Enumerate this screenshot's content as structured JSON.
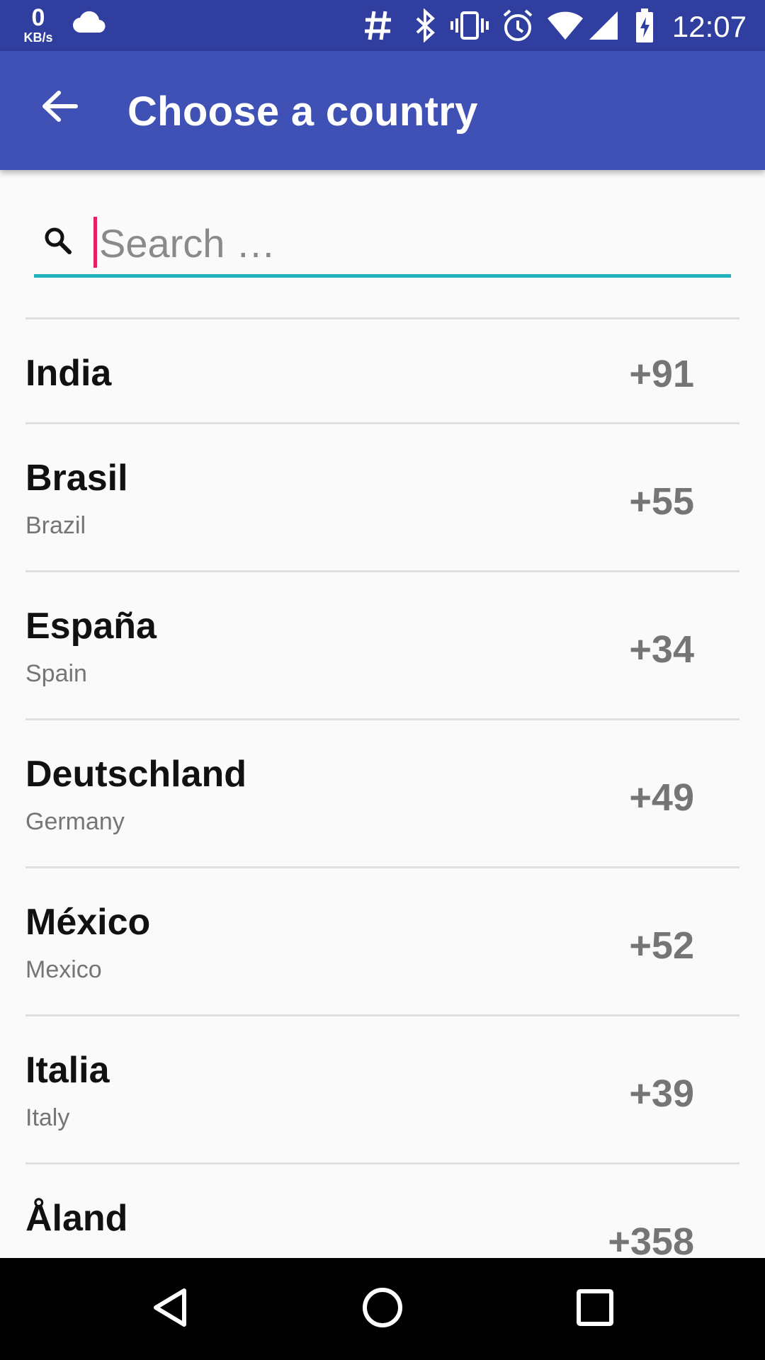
{
  "status_bar": {
    "net_speed_value": "0",
    "net_speed_unit": "KB/s",
    "time": "12:07",
    "icons": [
      "cloud-icon",
      "hash-icon",
      "bluetooth-icon",
      "vibrate-icon",
      "alarm-icon",
      "wifi-icon",
      "signal-icon",
      "battery-charging-icon"
    ]
  },
  "app_bar": {
    "title": "Choose a country",
    "back_icon": "arrow-back-icon"
  },
  "search": {
    "placeholder": "Search …",
    "value": "",
    "underline_color": "#1eb3bd",
    "cursor_color": "#e91e63"
  },
  "countries": [
    {
      "native": "India",
      "english": "",
      "code": "+91"
    },
    {
      "native": "Brasil",
      "english": "Brazil",
      "code": "+55"
    },
    {
      "native": "España",
      "english": "Spain",
      "code": "+34"
    },
    {
      "native": "Deutschland",
      "english": "Germany",
      "code": "+49"
    },
    {
      "native": "México",
      "english": "Mexico",
      "code": "+52"
    },
    {
      "native": "Italia",
      "english": "Italy",
      "code": "+39"
    },
    {
      "native": "Åland",
      "english": "",
      "code": "+358"
    }
  ],
  "nav_bar": {
    "icons": [
      "back-triangle-icon",
      "home-circle-icon",
      "recents-square-icon"
    ]
  },
  "colors": {
    "status_bar": "#303f9f",
    "app_bar": "#3f51b5",
    "background": "#fafafa"
  }
}
